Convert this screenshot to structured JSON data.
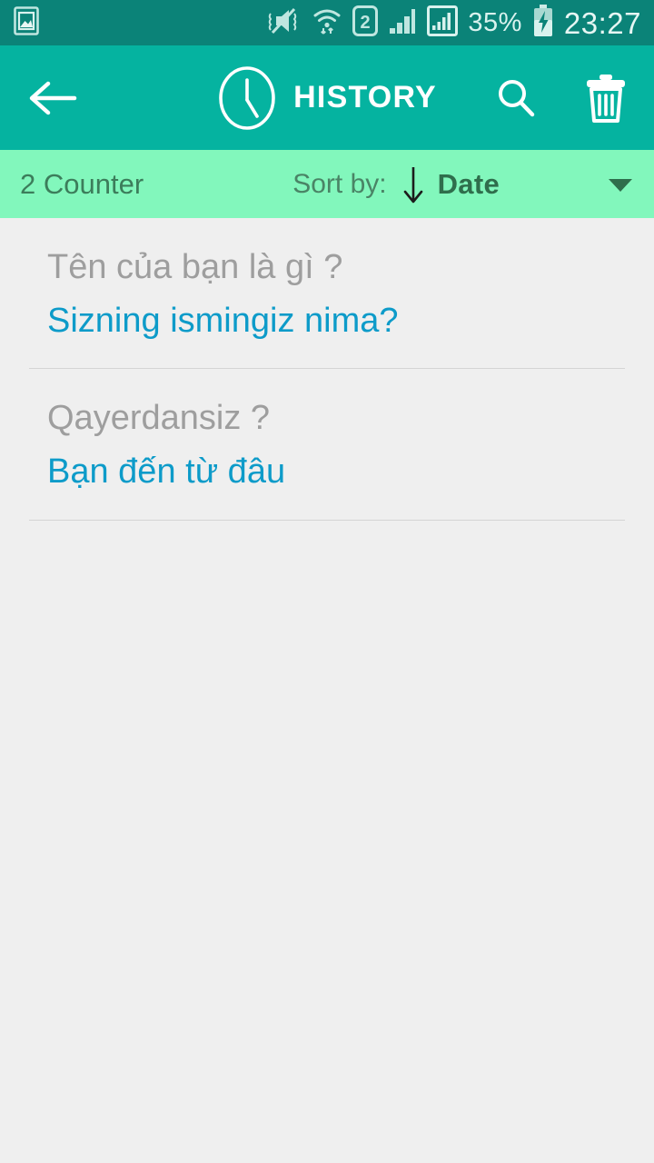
{
  "status_bar": {
    "gallery_icon": "gallery-icon",
    "vibrate_icon": "mute-vibrate-icon",
    "wifi_icon": "wifi-transfer-icon",
    "sim_label": "2",
    "signal1_icon": "signal-bars-icon",
    "signal2_icon": "signal-bars-boxed-icon",
    "battery_percent": "35%",
    "battery_icon": "battery-charging-icon",
    "time": "23:27"
  },
  "action_bar": {
    "back_icon": "back-arrow-icon",
    "title_icon": "clock-icon",
    "title": "HISTORY",
    "search_icon": "search-icon",
    "delete_icon": "trash-icon"
  },
  "sort_bar": {
    "counter": "2 Counter",
    "sort_label": "Sort by:",
    "sort_direction_icon": "arrow-down-icon",
    "sort_value": "Date",
    "dropdown_icon": "chevron-down-icon"
  },
  "history": {
    "items": [
      {
        "source": "Tên của bạn là gì ?",
        "target": "Sizning ismingiz nima?"
      },
      {
        "source": "Qayerdansiz ?",
        "target": "Bạn đến từ đâu"
      }
    ]
  },
  "colors": {
    "status_bar_bg": "#0b8378",
    "action_bar_bg": "#05b3a0",
    "sort_bar_bg": "#82f7bc",
    "content_bg": "#efefef",
    "source_text": "#9e9e9e",
    "target_text": "#0d9bc9",
    "counter_text": "#3c7d5b",
    "divider": "#d4d4d4"
  }
}
